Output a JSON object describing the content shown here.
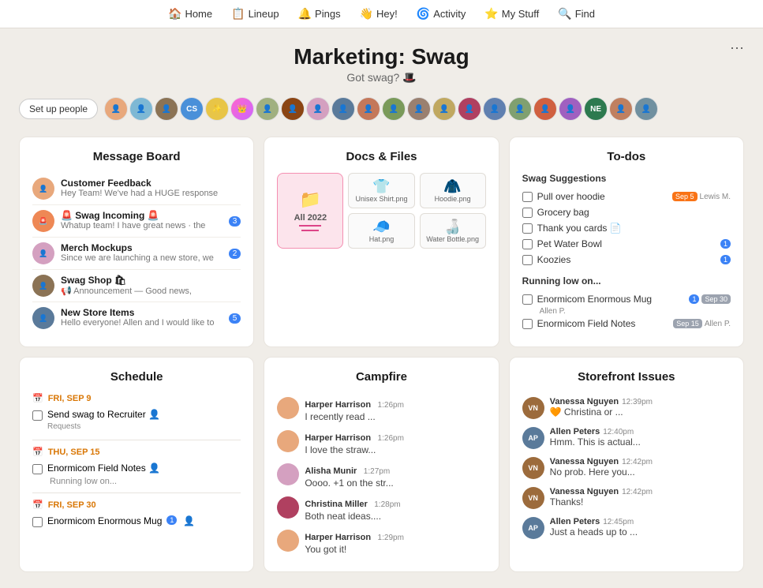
{
  "nav": {
    "items": [
      {
        "id": "home",
        "label": "Home",
        "icon": "🏠"
      },
      {
        "id": "lineup",
        "label": "Lineup",
        "icon": "📋"
      },
      {
        "id": "pings",
        "label": "Pings",
        "icon": "🔔"
      },
      {
        "id": "hey",
        "label": "Hey!",
        "icon": "👋"
      },
      {
        "id": "activity",
        "label": "Activity",
        "icon": "🌀"
      },
      {
        "id": "mystuff",
        "label": "My Stuff",
        "icon": "⭐"
      },
      {
        "id": "find",
        "label": "Find",
        "icon": "🔍"
      }
    ]
  },
  "project": {
    "title": "Marketing: Swag",
    "subtitle": "Got swag? 🎩"
  },
  "people": {
    "setup_label": "Set up people"
  },
  "message_board": {
    "title": "Message Board",
    "items": [
      {
        "id": "msg1",
        "title": "Customer Feedback",
        "preview": "Hey Team! We've had a HUGE response",
        "badge": ""
      },
      {
        "id": "msg2",
        "title": "🚨 Swag Incoming 🚨",
        "preview": "Whatup team! I have great news · the",
        "badge": "3"
      },
      {
        "id": "msg3",
        "title": "Merch Mockups",
        "preview": "Since we are launching a new store, we",
        "badge": "2"
      },
      {
        "id": "msg4",
        "title": "Swag Shop 🛍",
        "preview": "📢 Announcement — Good news,",
        "badge": ""
      },
      {
        "id": "msg5",
        "title": "New Store Items",
        "preview": "Hello everyone! Allen and I would like to",
        "badge": "5"
      }
    ]
  },
  "docs_files": {
    "title": "Docs & Files",
    "items": [
      {
        "id": "all2022",
        "label": "All 2022",
        "type": "folder",
        "featured": true
      },
      {
        "id": "shirt",
        "label": "Unisex Shirt.png",
        "type": "image",
        "icon": "👕"
      },
      {
        "id": "hoodie",
        "label": "Hoodie.png",
        "type": "image",
        "icon": "🧥"
      },
      {
        "id": "hat",
        "label": "Hat.png",
        "type": "image",
        "icon": "🧢"
      },
      {
        "id": "bottle",
        "label": "Water Bottle.png",
        "type": "image",
        "icon": "🍶"
      }
    ]
  },
  "todos": {
    "title": "To-dos",
    "sections": [
      {
        "title": "Swag Suggestions",
        "items": [
          {
            "label": "Pull over hoodie",
            "checked": false,
            "date": "Sep 5",
            "person": "Lewis M."
          },
          {
            "label": "Grocery bag",
            "checked": false,
            "date": "",
            "person": ""
          },
          {
            "label": "Thank you cards",
            "checked": false,
            "date": "",
            "person": "",
            "icon": "📄"
          },
          {
            "label": "Pet Water Bowl",
            "checked": false,
            "date": "",
            "person": "",
            "badge": "1"
          },
          {
            "label": "Koozies",
            "checked": false,
            "date": "",
            "person": "",
            "badge": "1"
          }
        ]
      },
      {
        "title": "Running low on...",
        "items": [
          {
            "label": "Enormicom Enormous Mug",
            "checked": false,
            "date": "Sep 30",
            "person": "Allen P.",
            "badge": "1"
          },
          {
            "label": "Enormicom Field Notes",
            "checked": false,
            "date": "Sep 15",
            "person": "Allen P."
          }
        ]
      }
    ]
  },
  "schedule": {
    "title": "Schedule",
    "dates": [
      {
        "label": "FRI, SEP 9",
        "items": [
          {
            "label": "Send swag to Recruiter Requests",
            "checked": false
          }
        ]
      },
      {
        "label": "THU, SEP 15",
        "items": [
          {
            "label": "Enormicom Field Notes",
            "checked": false
          },
          {
            "label": "Running low on...",
            "checked": false,
            "sub": true
          }
        ]
      },
      {
        "label": "FRI, SEP 30",
        "items": [
          {
            "label": "Enormicom Enormous Mug",
            "checked": false,
            "badge": "1"
          }
        ]
      }
    ]
  },
  "campfire": {
    "title": "Campfire",
    "messages": [
      {
        "name": "Harper Harrison",
        "time": "1:26pm",
        "text": "I recently read ..."
      },
      {
        "name": "Harper Harrison",
        "time": "1:26pm",
        "text": "I love the straw..."
      },
      {
        "name": "Alisha Munir",
        "time": "1:27pm",
        "text": "Oooo. +1 on the str..."
      },
      {
        "name": "Christina Miller",
        "time": "1:28pm",
        "text": "Both neat ideas...."
      },
      {
        "name": "Harper Harrison",
        "time": "1:29pm",
        "text": "You got it!"
      }
    ]
  },
  "storefront": {
    "title": "Storefront Issues",
    "messages": [
      {
        "name": "Vanessa Nguyen",
        "time": "12:39pm",
        "text": "🧡 Christina or ...",
        "initials": "VN",
        "color": "#9c6b3c"
      },
      {
        "name": "Allen Peters",
        "time": "12:40pm",
        "text": "Hmm. This is actual...",
        "initials": "AP",
        "color": "#5a7a9a"
      },
      {
        "name": "Vanessa Nguyen",
        "time": "12:42pm",
        "text": "No prob. Here you...",
        "initials": "VN",
        "color": "#9c6b3c"
      },
      {
        "name": "Vanessa Nguyen",
        "time": "12:42pm",
        "text": "Thanks!",
        "initials": "VN",
        "color": "#9c6b3c"
      },
      {
        "name": "Allen Peters",
        "time": "12:45pm",
        "text": "Just a heads up to ...",
        "initials": "AP",
        "color": "#5a7a9a"
      }
    ]
  },
  "more_button_label": "···"
}
